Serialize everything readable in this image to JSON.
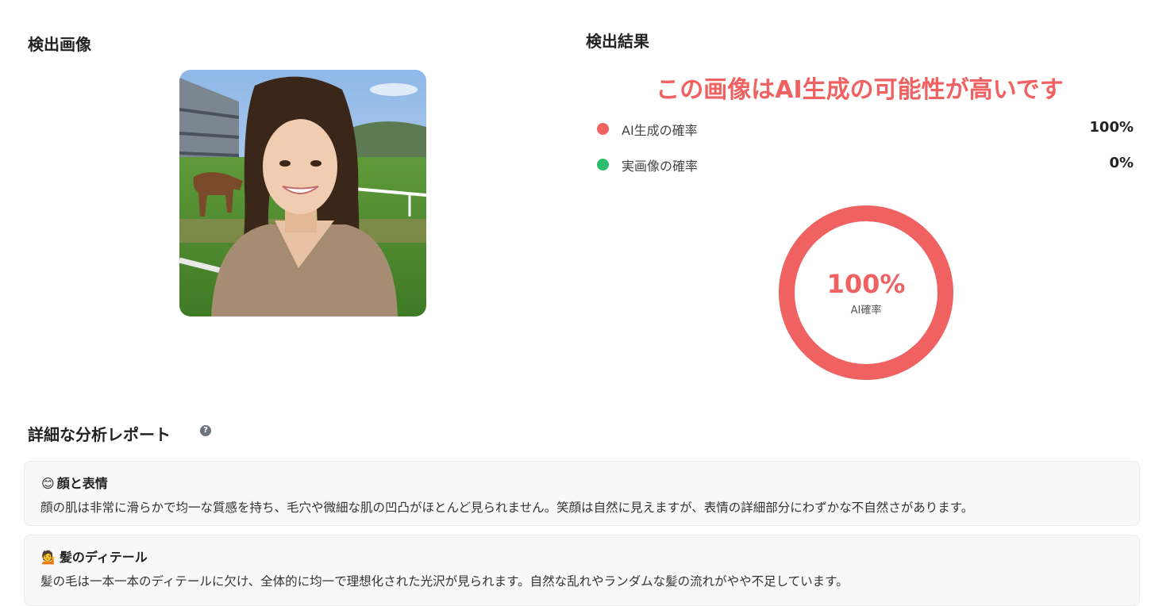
{
  "image_section": {
    "title": "検出画像"
  },
  "result_section": {
    "title": "検出結果",
    "verdict": "この画像はAI生成の可能性が高いです",
    "accent_color": "#f06262",
    "rows": [
      {
        "label": "AI生成の確率",
        "value": "100%",
        "dot_color": "#f06262"
      },
      {
        "label": "実画像の確率",
        "value": "0%",
        "dot_color": "#2dbd6e"
      }
    ],
    "gauge": {
      "percent_text": "100%",
      "caption": "AI確率",
      "fraction": 1.0
    }
  },
  "report": {
    "title": "詳細な分析レポート",
    "help_icon": "question-circle-icon",
    "help_glyph": "?",
    "items": [
      {
        "icon": "smiling-face-emoji",
        "emoji": "😊",
        "title": "顔と表情",
        "text": "顔の肌は非常に滑らかで均一な質感を持ち、毛穴や微細な肌の凹凸がほとんど見られません。笑顔は自然に見えますが、表情の詳細部分にわずかな不自然さがあります。"
      },
      {
        "icon": "haircut-emoji",
        "emoji": "💁",
        "title": "髪のディテール",
        "text": "髪の毛は一本一本のディテールに欠け、全体的に均一で理想化された光沢が見られます。自然な乱れやランダムな髪の流れがやや不足しています。"
      }
    ]
  }
}
